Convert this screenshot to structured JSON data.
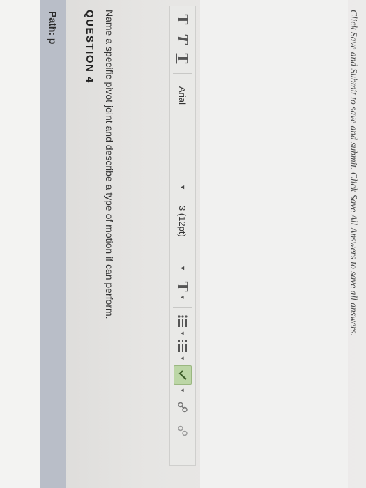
{
  "editor": {
    "path_label": "Path: p"
  },
  "question": {
    "title": "QUESTION 4",
    "prompt": "Name a specific pivot joint and describe a type of motion if can perform."
  },
  "toolbar": {
    "format_buttons": [
      "T",
      "T",
      "T"
    ],
    "font_family": "Arial",
    "font_size": "3 (12pt)",
    "text_color_icon": "text-color-icon",
    "list_icons": [
      "bullet-list-icon",
      "numbered-list-icon"
    ],
    "spellcheck_icon": "spellcheck-icon",
    "link_icon": "link-icon",
    "unlink_icon": "unlink-icon",
    "accent_color": "#bcd6a6"
  },
  "footer": {
    "instructions": "Click Save and Submit to save and submit. Click Save All Answers to save all answers."
  }
}
